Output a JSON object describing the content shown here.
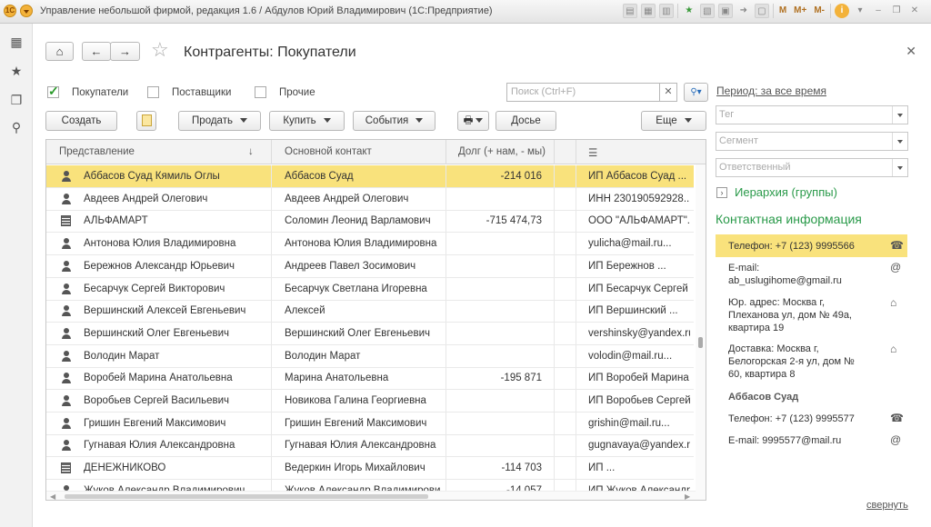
{
  "app_title": "Управление небольшой фирмой, редакция 1.6 / Абдулов Юрий Владимирович (1С:Предприятие)",
  "titlebar_icons": [
    "doc-icon",
    "print-icon",
    "calc-icon",
    "star-icon",
    "notes-icon",
    "calendar-icon",
    "arrow-icon",
    "panel-icon",
    "M",
    "M+",
    "M-",
    "info-icon",
    "chevron-down-icon",
    "minimize-icon",
    "restore-icon",
    "close-icon"
  ],
  "page_title": "Контрагенты: Покупатели",
  "filters": [
    {
      "label": "Покупатели",
      "checked": true
    },
    {
      "label": "Поставщики",
      "checked": false
    },
    {
      "label": "Прочие",
      "checked": false
    }
  ],
  "search": {
    "placeholder": "Поиск (Ctrl+F)"
  },
  "toolbar": {
    "create": "Создать",
    "sell": "Продать",
    "buy": "Купить",
    "events": "События",
    "dossier": "Досье",
    "more": "Еще"
  },
  "columns": [
    "Представление",
    "Основной контакт",
    "Долг (+ нам, - мы)"
  ],
  "rows": [
    {
      "type": "person",
      "name": "Аббасов Суад Кямиль Оглы",
      "contact": "Аббасов Суад",
      "debt": "-214 016",
      "info": "ИП Аббасов Суад ...",
      "selected": true
    },
    {
      "type": "person",
      "name": "Авдеев Андрей Олегович",
      "contact": "Авдеев Андрей Олегович",
      "debt": "",
      "info": "ИНН 230190592928..."
    },
    {
      "type": "org",
      "name": "АЛЬФАМАРТ",
      "contact": "Соломин Леонид Варламович",
      "debt": "-715 474,73",
      "info": "ООО \"АЛЬФАМАРТ\"..."
    },
    {
      "type": "person",
      "name": "Антонова Юлия Владимировна",
      "contact": "Антонова Юлия Владимировна",
      "debt": "",
      "info": "yulicha@mail.ru..."
    },
    {
      "type": "person",
      "name": "Бережнов Александр Юрьевич",
      "contact": "Андреев Павел Зосимович",
      "debt": "",
      "info": "ИП Бережнов ..."
    },
    {
      "type": "person",
      "name": "Бесарчук Сергей Викторович",
      "contact": "Бесарчук Светлана Игоревна",
      "debt": "",
      "info": "ИП Бесарчук Сергей ..."
    },
    {
      "type": "person",
      "name": "Вершинский Алексей Евгеньевич",
      "contact": "Алексей",
      "debt": "",
      "info": "ИП Вершинский ..."
    },
    {
      "type": "person",
      "name": "Вершинский Олег Евгеньевич",
      "contact": "Вершинский Олег Евгеньевич",
      "debt": "",
      "info": "vershinsky@yandex.ru..."
    },
    {
      "type": "person",
      "name": "Володин Марат",
      "contact": "Володин Марат",
      "debt": "",
      "info": "volodin@mail.ru..."
    },
    {
      "type": "person",
      "name": "Воробей Марина Анатольевна",
      "contact": "Марина Анатольевна",
      "debt": "-195 871",
      "info": "ИП Воробей Марина ..."
    },
    {
      "type": "person",
      "name": "Воробьев Сергей Васильевич",
      "contact": "Новикова Галина Георгиевна",
      "debt": "",
      "info": "ИП Воробьев Сергей ..."
    },
    {
      "type": "person",
      "name": "Гришин Евгений Максимович",
      "contact": "Гришин Евгений Максимович",
      "debt": "",
      "info": "grishin@mail.ru..."
    },
    {
      "type": "person",
      "name": "Гугнавая Юлия Александровна",
      "contact": "Гугнавая Юлия Александровна",
      "debt": "",
      "info": "gugnavaya@yandex.ru..."
    },
    {
      "type": "org",
      "name": "ДЕНЕЖНИКОВО",
      "contact": "Ведеркин Игорь Михайлович",
      "debt": "-114 703",
      "info": "ИП ..."
    },
    {
      "type": "person",
      "name": "Жуков Александр Владимирович",
      "contact": "Жуков Александр Владимирович",
      "debt": "-14 057",
      "info": "ИП Жуков Александр ..."
    }
  ],
  "right_panel": {
    "period": "Период: за все время",
    "tag_placeholder": "Тег",
    "segment_placeholder": "Сегмент",
    "responsible_placeholder": "Ответственный",
    "hierarchy": "Иерархия (группы)",
    "contacts_title": "Контактная информация",
    "phone": "Телефон: +7 (123) 9995566",
    "email_label": "E-mail:",
    "email": "ab_uslugihome@gmail.ru",
    "legal_address_1": "Юр. адрес: Москва г,",
    "legal_address_2": "Плеханова ул, дом № 49а,",
    "legal_address_3": "квартира 19",
    "delivery_1": "Доставка: Москва г,",
    "delivery_2": "Белогорская 2-я ул, дом №",
    "delivery_3": "60, квартира 8",
    "contact_name": "Аббасов Суад",
    "contact_phone": "Телефон: +7 (123) 9995577",
    "contact_email": "E-mail: 9995577@mail.ru",
    "collapse": "свернуть"
  },
  "colors": {
    "selection": "#f9e27c",
    "accent_green": "#2a9a4a",
    "logo_orange": "#f3b23a"
  }
}
